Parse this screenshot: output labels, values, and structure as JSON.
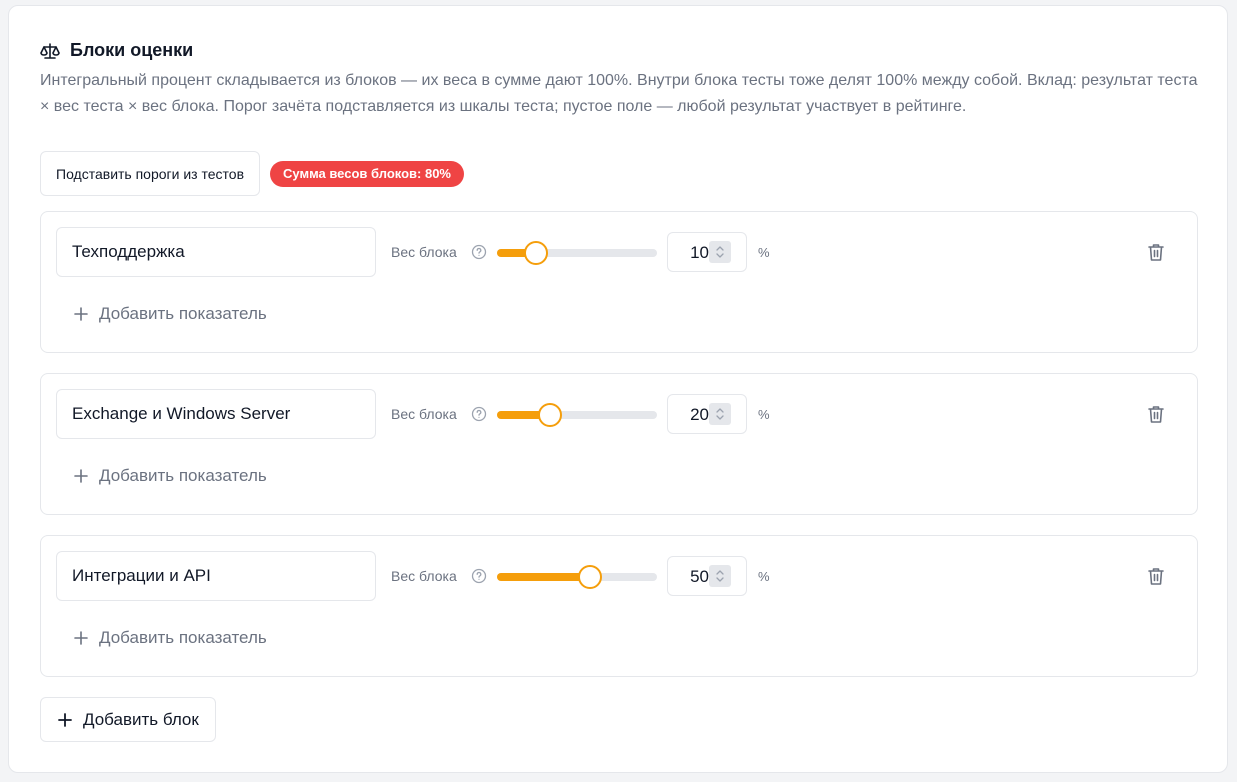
{
  "section": {
    "icon": "scale-icon",
    "title": "Блоки оценки",
    "description": "Интегральный процент складывается из блоков — их веса в сумме дают 100%. Внутри блока тесты тоже делят 100% между собой. Вклад: результат теста × вес теста × вес блока. Порог зачёта подставляется из шкалы теста; пустое поле — любой результат участвует в рейтинге."
  },
  "toolbar": {
    "thresholds_button": "Подставить пороги из тестов",
    "sum_badge": "Сумма весов блоков: 80%"
  },
  "blocks": [
    {
      "name": "Техподдержка",
      "weight_label": "Вес блока",
      "weight": "10",
      "weight_fraction": 0.1,
      "unit": "%",
      "add_indicator": "Добавить показатель"
    },
    {
      "name": "Exchange и Windows Server",
      "weight_label": "Вес блока",
      "weight": "20",
      "weight_fraction": 0.2,
      "unit": "%",
      "add_indicator": "Добавить показатель"
    },
    {
      "name": "Интеграции и API",
      "weight_label": "Вес блока",
      "weight": "50",
      "weight_fraction": 0.5,
      "unit": "%",
      "add_indicator": "Добавить показатель"
    }
  ],
  "footer": {
    "add_block": "Добавить блок"
  },
  "colors": {
    "accent": "#f59e0b",
    "danger": "#ef4444",
    "muted": "#6b7280"
  }
}
